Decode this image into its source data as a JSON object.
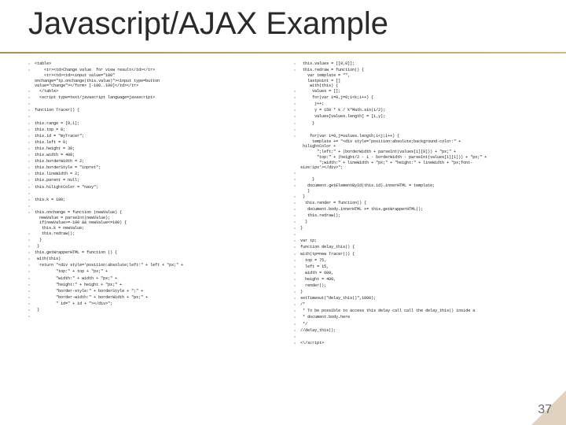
{
  "title": "Javascript/AJAX Example",
  "pageNumber": "37",
  "leftLines": [
    "<table>",
    "    <tr><td>Change value  for view result</td></tr>\n    <tr><td><td><input value=\"100\"\nonchange=\"tp.onchange(this.value)\"><input type=button\nvalue=\"change\"></form> [-100..100]</td></tr>",
    "  </table>",
    "  <script type=text/javascript language=javascript>",
    "",
    "function Tracer() {",
    "",
    "this.range = [0,1];",
    "this.top = 0;",
    "this.id = \"myTracer\";",
    "this.left = 0;",
    "this.height = 30;",
    "this.width = 400;",
    "this.borderWidth = 2;",
    "this.borderStyle = \"inpret\";",
    "this.lineWidth = 2;",
    "this.parent = null;",
    "this.hilightColor = \"navy\";",
    "",
    "this.k = 100;",
    "",
    "this.onchange = function (newValue) {\n  newValue = parseInt(newValue);\n  if(newValue>=-100 && newValue<=100) {\n   this.k = newValue;",
    "   this.redraw();",
    "  }",
    " }",
    "this.getWrapperHTML = function () {",
    " with(this)",
    "  return \"<div style='position:absolute;left:\" + left + \"px;\" +",
    "         \"top:\" + top + \"px;\" +",
    "         \"width:\" + width + \"px;\" +",
    "         \"height:\" + height + \"px;\" +",
    "         \"border-style:\" + borderStyle + \";\" +",
    "         \"border-width:\" + borderWidth + \"px;\" +",
    "         \" id=\" + id + \"></div>\";",
    " }",
    ""
  ],
  "rightLines": [
    " this.values = [[0,0]];",
    " this.redraw = function() {\n   var template = \"\",\n   lastpoint = []\n    with(this) {",
    "     values = [];",
    "     for(var i=0,j=0;i<k;i++) {",
    "      j++;",
    "      y = 150 * k / k*Math.sin(i/2);",
    "      values[values.length] = [i,y];",
    "     }",
    "",
    "    for(var i=0,j=values.length;i<j;i++) {\n     template += \"<div style='position:absolute;background-color:\" +\n hilightColor + \n       \";left:\" + (borderWidth + parseInt(values[i][0])) + \"px;\" +\n       \"top:\" + (height/2 - 1 - borderWidth - parseInt(values[i][1])) + \"px;\" +\n        \";width:\" + lineWidth + \"px;\" + \"height:\" + lineWidth + \"px;font-\nsize:1px'></div>\";",
    "",
    "     }",
    "   document.getElementById(this.id).innerHTML = template;\n   }",
    " }",
    "  this.render = function() {",
    "   document.body.innerHTML += this.getWrapperHTML();",
    "   this.redraw();",
    "  }",
    "}",
    "",
    "var tp;",
    "function delay_this() {",
    "with(tp=new Tracer()) {",
    "  top = 75,",
    "  left = 15,",
    "  width = 600,",
    "  height = 400,",
    "  render();",
    "}",
    "setTimeout(\"delay_this()\",1000);",
    "/*",
    " * To be possible to access this delay call call the delay_this() inside a",
    " * document.body.here",
    " */",
    "//delay_this();",
    "",
    "<\\/script>"
  ]
}
